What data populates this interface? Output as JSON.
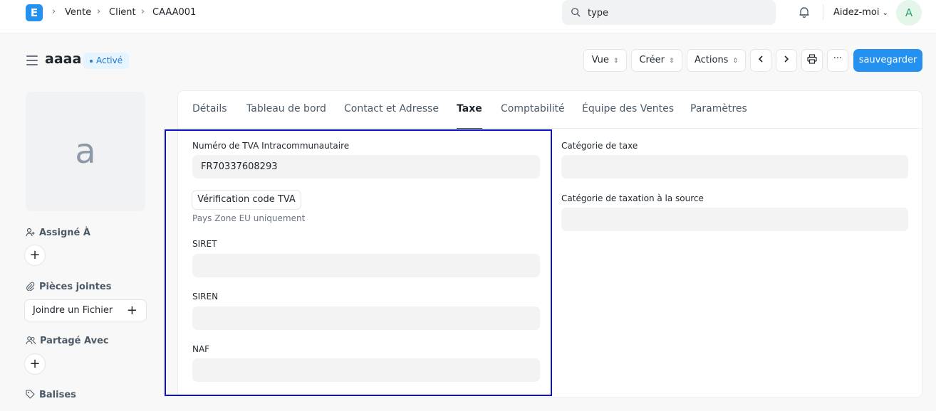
{
  "navbar": {
    "logo": "E",
    "breadcrumbs": [
      "Vente",
      "Client",
      "CAAA001"
    ],
    "search_value": "type",
    "help_label": "Aidez-moi",
    "avatar_initial": "A"
  },
  "header": {
    "title": "aaaa",
    "status": "Activé",
    "buttons": {
      "view": "Vue",
      "create": "Créer",
      "actions": "Actions",
      "more": "···",
      "save": "sauvegarder"
    }
  },
  "sidebar": {
    "image_initial": "a",
    "assigned_label": "Assigné À",
    "attachments_label": "Pièces jointes",
    "attach_button": "Joindre un Fichier",
    "shared_label": "Partagé Avec",
    "tags_label": "Balises"
  },
  "tabs": [
    "Détails",
    "Tableau de bord",
    "Contact et Adresse",
    "Taxe",
    "Comptabilité",
    "Équipe des Ventes",
    "Paramètres"
  ],
  "active_tab": "Taxe",
  "form": {
    "vat_label": "Numéro de TVA Intracommunautaire",
    "vat_value": "FR70337608293",
    "vat_check_button": "Vérification code TVA",
    "vat_hint": "Pays Zone EU uniquement",
    "siret_label": "SIRET",
    "siret_value": "",
    "siren_label": "SIREN",
    "siren_value": "",
    "naf_label": "NAF",
    "naf_value": "",
    "tax_category_label": "Catégorie de taxe",
    "tax_category_value": "",
    "withholding_label": "Catégorie de taxation à la source",
    "withholding_value": ""
  },
  "colors": {
    "primary": "#2490ef",
    "highlight_border": "#0a11c8",
    "status_bg": "#e6f4ff"
  }
}
